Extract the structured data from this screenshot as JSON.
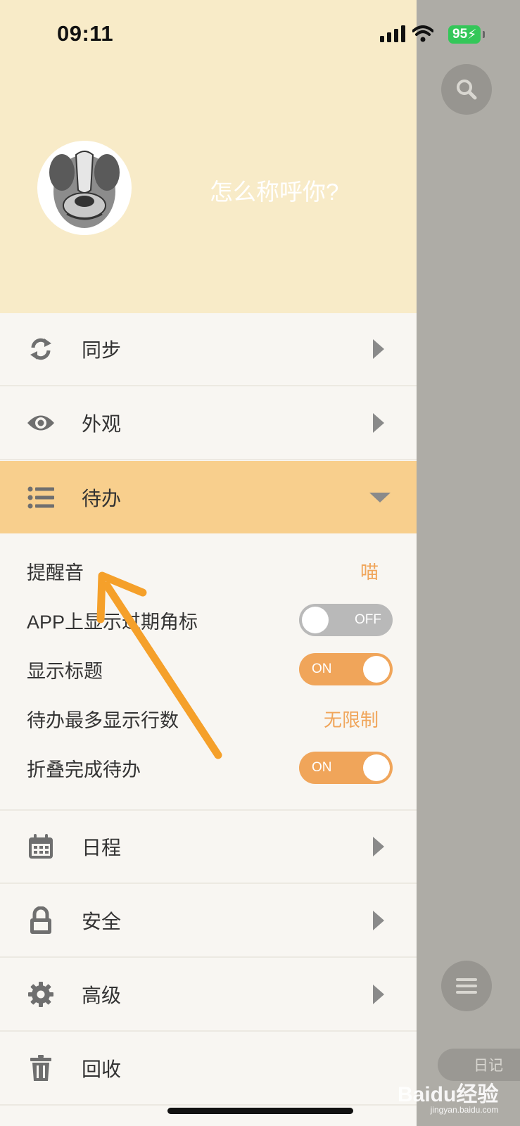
{
  "status_bar": {
    "time": "09:11",
    "battery": "95"
  },
  "profile": {
    "name_placeholder": "怎么称呼你?"
  },
  "menu": [
    {
      "label": "同步",
      "icon": "sync-icon"
    },
    {
      "label": "外观",
      "icon": "eye-icon"
    },
    {
      "label": "待办",
      "icon": "list-icon",
      "expanded": true
    },
    {
      "label": "日程",
      "icon": "calendar-icon"
    },
    {
      "label": "安全",
      "icon": "lock-icon"
    },
    {
      "label": "高级",
      "icon": "gear-icon"
    },
    {
      "label": "回收",
      "icon": "trash-icon"
    }
  ],
  "todo_settings": {
    "reminder": {
      "label": "提醒音",
      "value": "喵"
    },
    "badge": {
      "label": "APP上显示过期角标",
      "state": "OFF"
    },
    "show_title": {
      "label": "显示标题",
      "state": "ON"
    },
    "max_rows": {
      "label": "待办最多显示行数",
      "value": "无限制"
    },
    "collapse_done": {
      "label": "折叠完成待办",
      "state": "ON"
    }
  },
  "background": {
    "diary_tab": "日记"
  },
  "watermark": {
    "text": "Baidu经验",
    "sub": "jingyan.baidu.com"
  },
  "colors": {
    "accent": "#f0a55a",
    "header_bg": "#f8ebc8",
    "active_row": "#f8cf8d",
    "annotation_arrow": "#f5a02a"
  }
}
